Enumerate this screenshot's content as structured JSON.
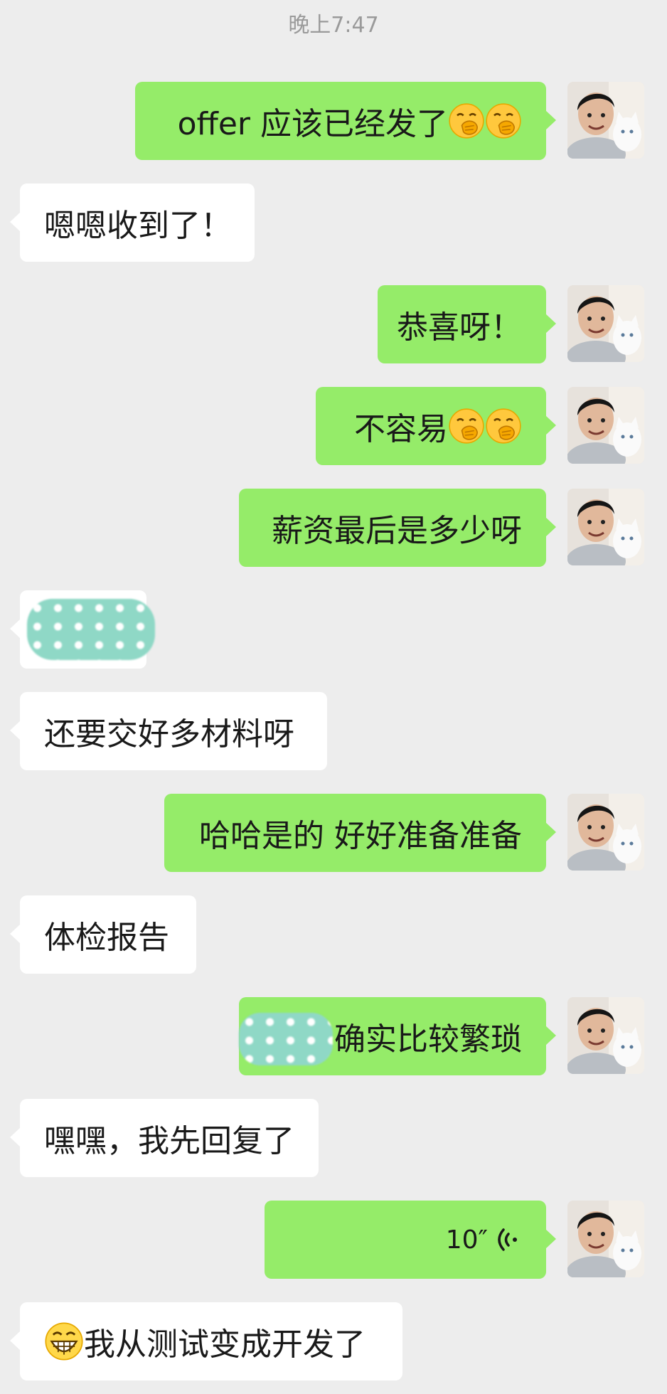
{
  "header": {
    "timestamp": "晚上7:47"
  },
  "messages": [
    {
      "side": "me",
      "text": "offer 应该已经发了",
      "emoji": "face-with-hand-over-mouth-icon"
    },
    {
      "side": "other",
      "text": "嗯嗯收到了！"
    },
    {
      "side": "me",
      "text": "恭喜呀！"
    },
    {
      "side": "me",
      "text": "不容易",
      "emoji": "face-with-hand-over-mouth-icon"
    },
    {
      "side": "me",
      "text": "薪资最后是多少呀"
    },
    {
      "side": "other",
      "text": "",
      "note": "redacted"
    },
    {
      "side": "other",
      "text": "还要交好多材料呀"
    },
    {
      "side": "me",
      "text": "哈哈是的 好好准备准备"
    },
    {
      "side": "other",
      "text": "体检报告"
    },
    {
      "side": "me",
      "text": "确实比较繁琐",
      "note": "partially redacted"
    },
    {
      "side": "other",
      "text": "嘿嘿，我先回复了"
    },
    {
      "side": "me",
      "voice_duration": "10″"
    },
    {
      "side": "other",
      "text": "我从测试变成开发了",
      "emoji": "grinning-face-icon"
    }
  ],
  "colors": {
    "me_bubble": "#95ec69",
    "other_bubble": "#ffffff",
    "background": "#ededed"
  }
}
